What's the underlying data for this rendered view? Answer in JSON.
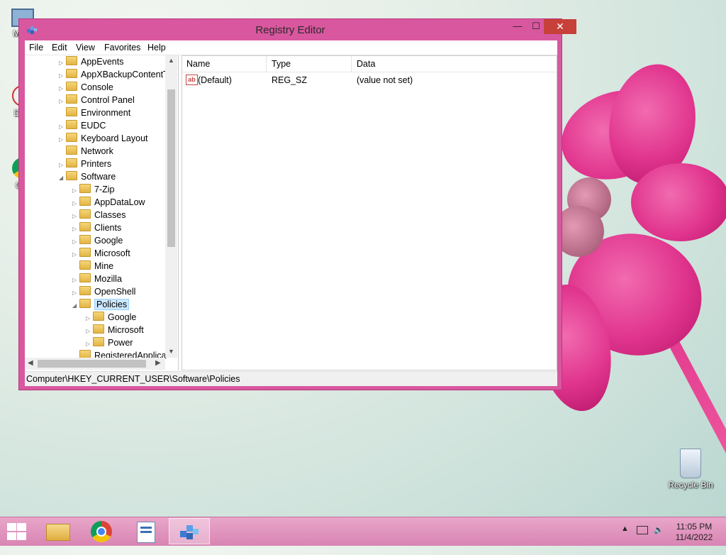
{
  "desktop": {
    "icons": [
      {
        "label": "My C"
      },
      {
        "label": "Data"
      },
      {
        "label": "G C"
      },
      {
        "label": "Recycle Bin"
      }
    ]
  },
  "window": {
    "title": "Registry Editor",
    "controls": {
      "minimize": "—",
      "maximize": "☐",
      "close": "✕"
    },
    "menu": [
      "File",
      "Edit",
      "View",
      "Favorites",
      "Help"
    ],
    "tree": [
      {
        "label": "AppEvents",
        "depth": 0,
        "expander": "▷"
      },
      {
        "label": "AppXBackupContentT",
        "depth": 0,
        "expander": "▷"
      },
      {
        "label": "Console",
        "depth": 0,
        "expander": "▷"
      },
      {
        "label": "Control Panel",
        "depth": 0,
        "expander": "▷"
      },
      {
        "label": "Environment",
        "depth": 0,
        "expander": ""
      },
      {
        "label": "EUDC",
        "depth": 0,
        "expander": "▷"
      },
      {
        "label": "Keyboard Layout",
        "depth": 0,
        "expander": "▷"
      },
      {
        "label": "Network",
        "depth": 0,
        "expander": ""
      },
      {
        "label": "Printers",
        "depth": 0,
        "expander": "▷"
      },
      {
        "label": "Software",
        "depth": 0,
        "expander": "◢"
      },
      {
        "label": "7-Zip",
        "depth": 1,
        "expander": "▷"
      },
      {
        "label": "AppDataLow",
        "depth": 1,
        "expander": "▷"
      },
      {
        "label": "Classes",
        "depth": 1,
        "expander": "▷"
      },
      {
        "label": "Clients",
        "depth": 1,
        "expander": "▷"
      },
      {
        "label": "Google",
        "depth": 1,
        "expander": "▷"
      },
      {
        "label": "Microsoft",
        "depth": 1,
        "expander": "▷"
      },
      {
        "label": "Mine",
        "depth": 1,
        "expander": ""
      },
      {
        "label": "Mozilla",
        "depth": 1,
        "expander": "▷"
      },
      {
        "label": "OpenShell",
        "depth": 1,
        "expander": "▷"
      },
      {
        "label": "Policies",
        "depth": 1,
        "expander": "◢",
        "selected": true
      },
      {
        "label": "Google",
        "depth": 2,
        "expander": "▷"
      },
      {
        "label": "Microsoft",
        "depth": 2,
        "expander": "▷"
      },
      {
        "label": "Power",
        "depth": 2,
        "expander": "▷"
      },
      {
        "label": "RegisteredApplica",
        "depth": 1,
        "expander": ""
      }
    ],
    "list": {
      "columns": [
        "Name",
        "Type",
        "Data"
      ],
      "rows": [
        {
          "name": "(Default)",
          "type": "REG_SZ",
          "data": "(value not set)"
        }
      ]
    },
    "status": "Computer\\HKEY_CURRENT_USER\\Software\\Policies"
  },
  "taskbar": {
    "clock_time": "11:05 PM",
    "clock_date": "11/4/2022",
    "tray_chevron": "▲"
  }
}
